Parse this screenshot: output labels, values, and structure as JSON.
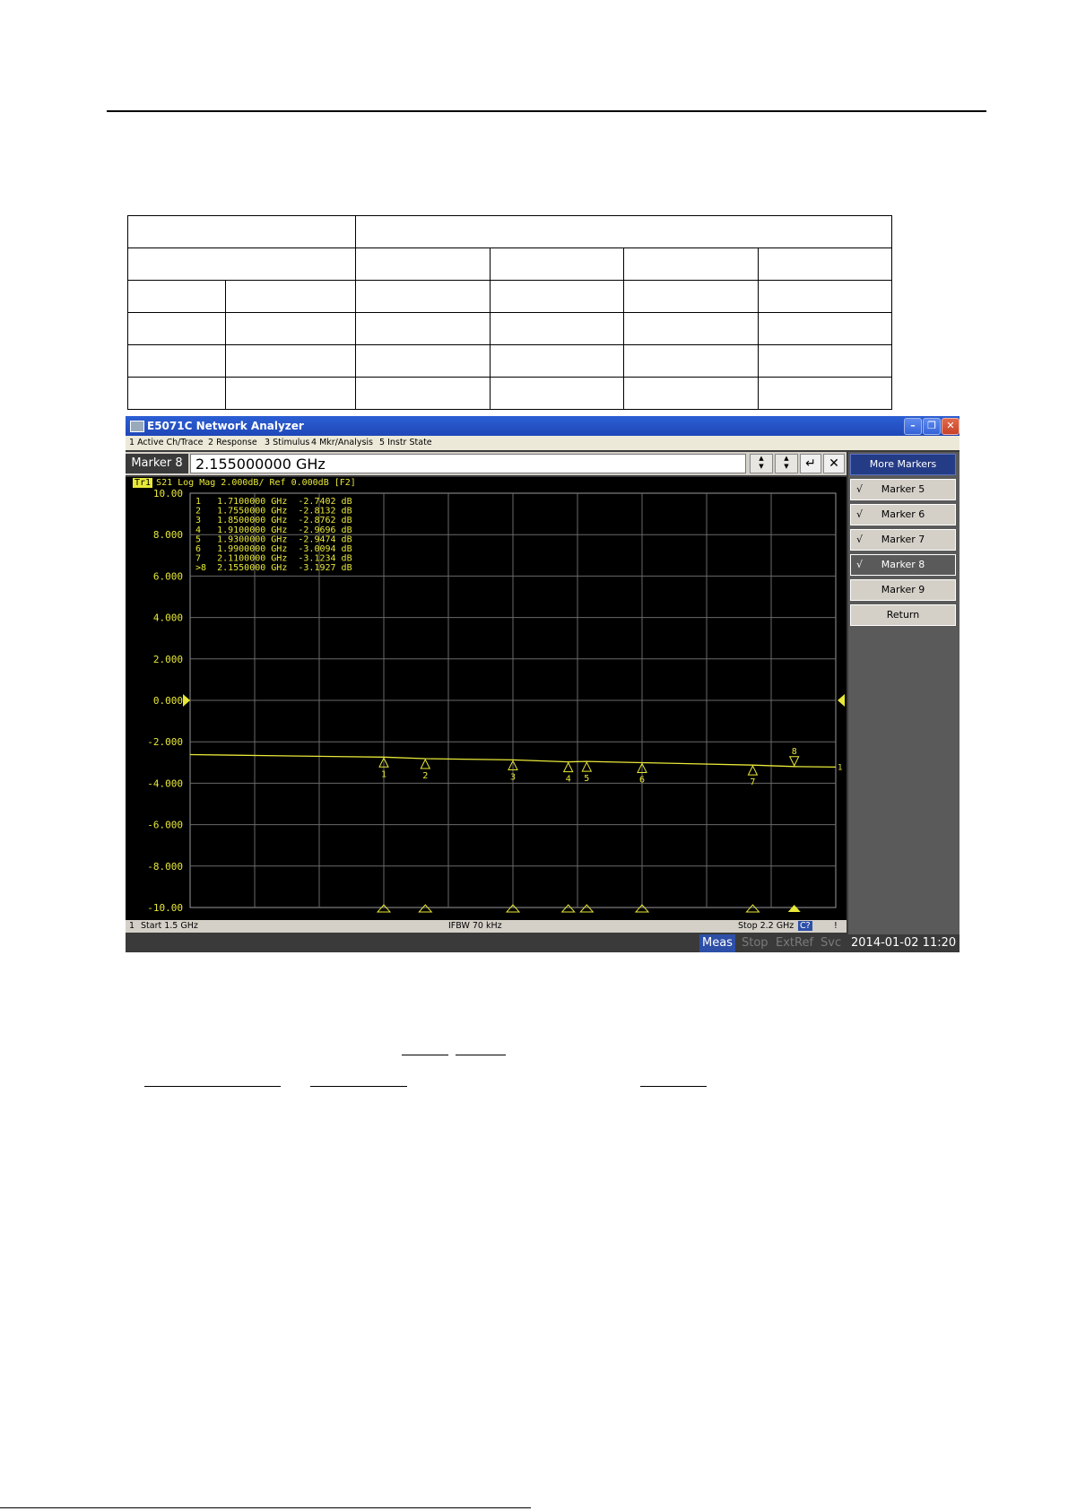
{
  "window": {
    "title": "E5071C Network Analyzer",
    "menu": [
      "1 Active Ch/Trace",
      "2 Response",
      "3 Stimulus",
      "4 Mkr/Analysis",
      "5 Instr State"
    ],
    "controls": [
      "minimize-icon",
      "restore-icon",
      "close-icon"
    ]
  },
  "entry": {
    "label": "Marker 8",
    "value": "2.155000000 GHz"
  },
  "softkeys": [
    {
      "label": "More Markers",
      "checked": false
    },
    {
      "label": "Marker 5",
      "checked": true
    },
    {
      "label": "Marker 6",
      "checked": true
    },
    {
      "label": "Marker 7",
      "checked": true
    },
    {
      "label": "Marker 8",
      "checked": true
    },
    {
      "label": "Marker 9",
      "checked": false
    },
    {
      "label": "Return",
      "checked": false
    }
  ],
  "trace_header": {
    "badge": "Tr1",
    "text": "S21 Log Mag 2.000dB/ Ref 0.000dB [F2]"
  },
  "marker_table": [
    "1   1.7100000 GHz  -2.7402 dB",
    "2   1.7550000 GHz  -2.8132 dB",
    "3   1.8500000 GHz  -2.8762 dB",
    "4   1.9100000 GHz  -2.9696 dB",
    "5   1.9300000 GHz  -2.9474 dB",
    "6   1.9900000 GHz  -3.0094 dB",
    "7   2.1100000 GHz  -3.1234 dB",
    ">8  2.1550000 GHz  -3.1927 dB"
  ],
  "chart_data": {
    "type": "line",
    "ylim": [
      -10,
      10
    ],
    "xlim": [
      1.5,
      2.2
    ],
    "y_ticks": [
      "10.00",
      "8.000",
      "6.000",
      "4.000",
      "2.000",
      "0.000",
      "-2.000",
      "-4.000",
      "-6.000",
      "-8.000",
      "-10.00"
    ],
    "series": [
      {
        "x": [
          1.5,
          1.6,
          1.71,
          1.755,
          1.85,
          1.91,
          1.93,
          1.99,
          2.11,
          2.155,
          2.2
        ],
        "values": [
          -2.62,
          -2.68,
          -2.7402,
          -2.8132,
          -2.8762,
          -2.9696,
          -2.9474,
          -3.0094,
          -3.1234,
          -3.1927,
          -3.22
        ]
      }
    ],
    "markers": [
      {
        "label": "1",
        "x": 1.71,
        "y": -2.7402
      },
      {
        "label": "2",
        "x": 1.755,
        "y": -2.8132
      },
      {
        "label": "3",
        "x": 1.85,
        "y": -2.8762
      },
      {
        "label": "4",
        "x": 1.91,
        "y": -2.9696
      },
      {
        "label": "5",
        "x": 1.93,
        "y": -2.9474
      },
      {
        "label": "6",
        "x": 1.99,
        "y": -3.0094
      },
      {
        "label": "7",
        "x": 2.11,
        "y": -3.1234
      },
      {
        "label": "8",
        "x": 2.155,
        "y": -3.1927,
        "active": true
      }
    ],
    "trace_color": "#e8e838"
  },
  "status": {
    "channel": "1",
    "start": "Start 1.5 GHz",
    "ifbw": "IFBW 70 kHz",
    "stop": "Stop 2.2 GHz",
    "cal": "C?",
    "flag": "!"
  },
  "bottom_bar": {
    "meas": "Meas",
    "stop": "Stop",
    "extref": "ExtRef",
    "svc": "Svc",
    "datetime": "2014-01-02 11:20"
  },
  "colors": {
    "title_blue": "#2355cc",
    "trace_yellow": "#e8e838",
    "panel_gray": "#d4d0c8",
    "meas_blue": "#2d4fa8"
  }
}
